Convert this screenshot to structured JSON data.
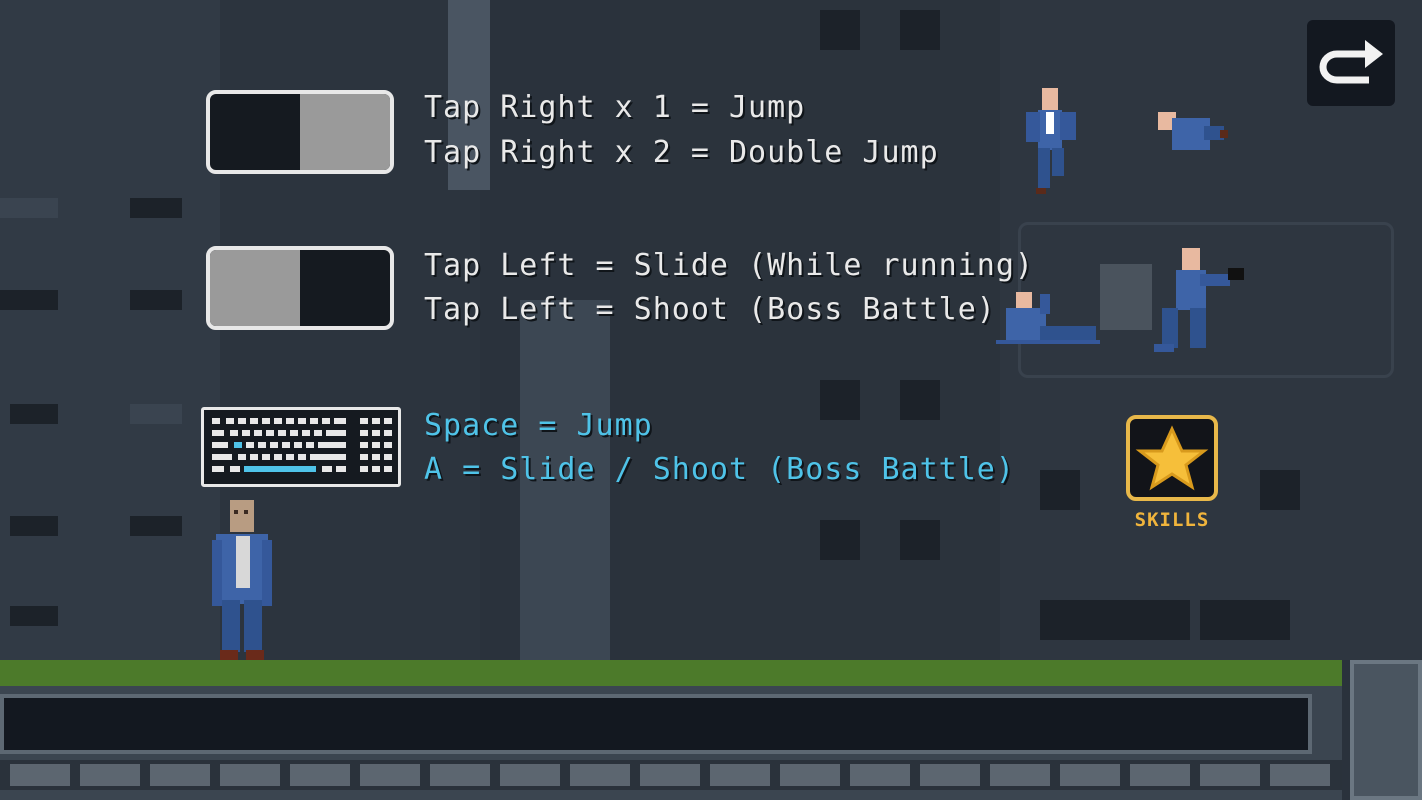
{
  "instructions": {
    "tap_right_jump": "Tap Right x 1 = Jump",
    "tap_right_double": "Tap Right x 2 = Double Jump",
    "tap_left_slide": "Tap Left = Slide (While running)",
    "tap_left_shoot": "Tap Left = Shoot (Boss Battle)",
    "key_space": "Space = Jump",
    "key_a": "A = Slide / Shoot (Boss Battle)"
  },
  "buttons": {
    "skills_label": "SKILLS",
    "skills_icon": "star-icon",
    "back_icon": "redo-arrow-icon"
  },
  "colors": {
    "instruction_text": "#e9e9e9",
    "keyboard_text": "#4fc3e8",
    "skills_accent": "#e8b84a",
    "grass": "#4c7a2a",
    "player_suit": "#3e64a8"
  }
}
